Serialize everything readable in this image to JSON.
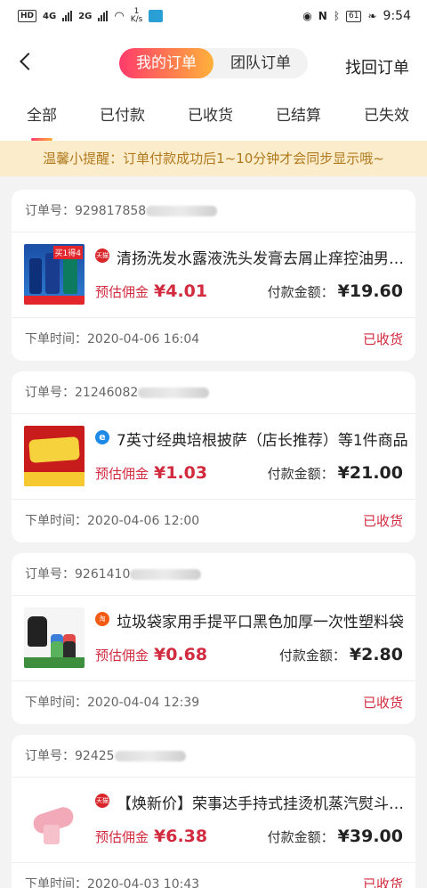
{
  "status_bar": {
    "hd": "HD",
    "sig1": "4G",
    "sig2": "2G",
    "speed_val": "1",
    "speed_unit": "K/s",
    "battery": "61",
    "time": "9:54"
  },
  "header": {
    "tab_my": "我的订单",
    "tab_team": "团队订单",
    "recover": "找回订单"
  },
  "tabs": [
    "全部",
    "已付款",
    "已收货",
    "已结算",
    "已失效"
  ],
  "notice": "温馨小提醒：订单付款成功后1~10分钟才会同步显示哦~",
  "labels": {
    "order_no": "订单号：",
    "commission": "预估佣金",
    "amount": "付款金额：",
    "time": "下单时间："
  },
  "orders": [
    {
      "order_no": "929817858",
      "shop_icon": "tmall-icon",
      "shop_icon_text": "天猫",
      "shop_color": "#d8262b",
      "title": "清扬洗发水露液洗头发膏去屑止痒控油男士女士正品",
      "commission": "¥4.01",
      "amount": "¥19.60",
      "time": "2020-04-06 16:04",
      "status": "已收货",
      "thumb_tag": "买1得4"
    },
    {
      "order_no": "21246082",
      "shop_icon": "ele-icon",
      "shop_icon_text": "e",
      "shop_color": "#1e8ae8",
      "title": "7英寸经典培根披萨（店长推荐）等1件商品",
      "commission": "¥1.03",
      "amount": "¥21.00",
      "time": "2020-04-06 12:00",
      "status": "已收货"
    },
    {
      "order_no": "9261410",
      "shop_icon": "taobao-icon",
      "shop_icon_text": "淘",
      "shop_color": "#f35b14",
      "title": "垃圾袋家用手提平口黑色加厚一次性塑料袋",
      "commission": "¥0.68",
      "amount": "¥2.80",
      "time": "2020-04-04 12:39",
      "status": "已收货"
    },
    {
      "order_no": "92425",
      "shop_icon": "tmall-icon",
      "shop_icon_text": "天猫",
      "shop_color": "#d8262b",
      "title": "【焕新价】荣事达手持式挂烫机蒸汽熨斗家用",
      "commission": "¥6.38",
      "amount": "¥39.00",
      "time": "2020-04-03 10:43",
      "status": "已收货"
    }
  ]
}
